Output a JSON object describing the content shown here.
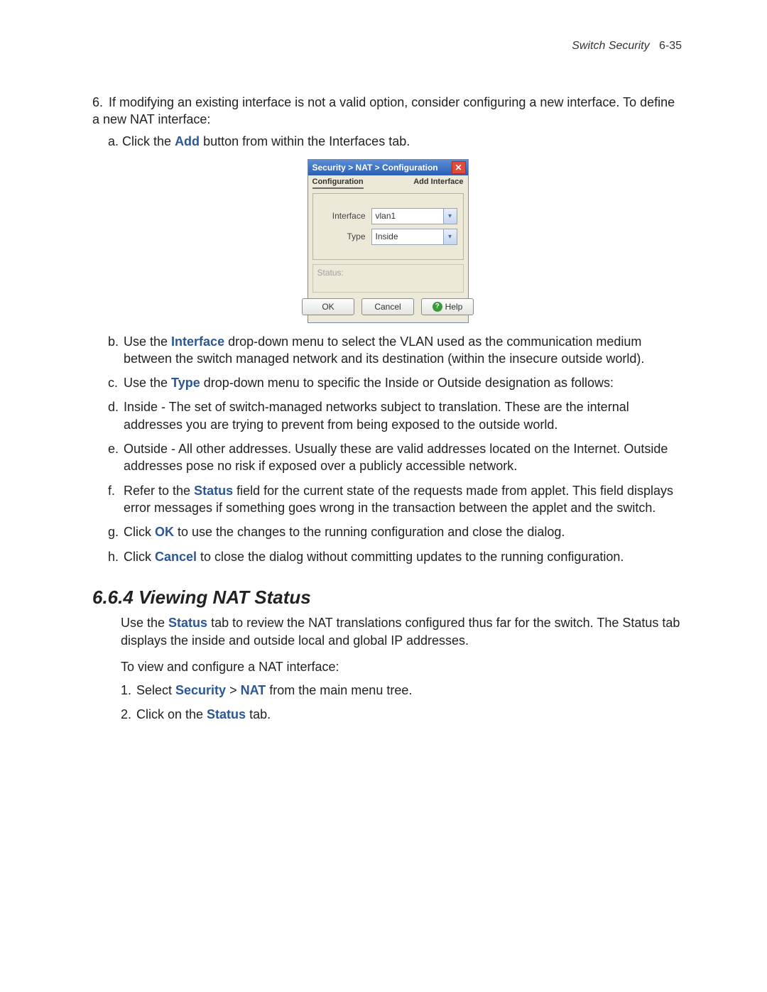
{
  "header": {
    "chapter_title": "Switch Security",
    "page_ref": "6-35"
  },
  "step6": {
    "number": "6.",
    "text": "If modifying an existing interface is not a valid option, consider configuring a new interface. To define a new NAT interface:"
  },
  "sub_a": {
    "letter": "a.",
    "pre": "Click the ",
    "bold": "Add",
    "post": " button from within the Interfaces tab."
  },
  "dialog": {
    "title": "Security > NAT > Configuration",
    "tab_left": "Configuration",
    "tab_right": "Add Interface",
    "rows": {
      "interface_label": "Interface",
      "interface_value": "vlan1",
      "type_label": "Type",
      "type_value": "Inside"
    },
    "status_label": "Status:",
    "buttons": {
      "ok": "OK",
      "cancel": "Cancel",
      "help": "Help"
    }
  },
  "subs": {
    "b": {
      "letter": "b.",
      "t1": "Use the ",
      "bold": "Interface",
      "t2": " drop-down menu to select the VLAN used as the communication medium between the switch managed network and its destination (within the insecure outside world)."
    },
    "c": {
      "letter": "c.",
      "t1": "Use the ",
      "bold": "Type",
      "t2": " drop-down menu to specific the Inside or Outside designation as follows:"
    },
    "d": {
      "letter": "d.",
      "text": "Inside - The set of switch-managed networks subject to translation. These are the internal addresses you are trying to prevent from being exposed to the outside world."
    },
    "e": {
      "letter": "e.",
      "text": "Outside - All other addresses. Usually these are valid addresses located on the Internet. Outside addresses pose no risk if exposed over a publicly accessible network."
    },
    "f": {
      "letter": "f.",
      "t1": "Refer to the ",
      "bold": "Status",
      "t2": " field for the current state of the requests made from applet. This field displays error messages if something goes wrong in the transaction between the applet and the switch."
    },
    "g": {
      "letter": "g.",
      "t1": "Click ",
      "bold": "OK",
      "t2": " to use the changes to the running configuration and close the dialog."
    },
    "h": {
      "letter": "h.",
      "t1": "Click ",
      "bold": "Cancel",
      "t2": " to close the dialog without committing updates to the running configuration."
    }
  },
  "section": {
    "heading": "6.6.4  Viewing NAT Status",
    "intro_t1": "Use the ",
    "intro_bold": "Status",
    "intro_t2": " tab to review the NAT translations configured thus far for the switch. The Status tab displays the inside and outside local and global IP addresses.",
    "lead": "To view and configure a NAT interface:",
    "steps": {
      "s1": {
        "n": "1.",
        "t1": "Select ",
        "b1": "Security",
        "gt": " > ",
        "b2": "NAT",
        "t2": " from the main menu tree."
      },
      "s2": {
        "n": "2.",
        "t1": "Click on the ",
        "bold": "Status",
        "t2": " tab."
      }
    }
  }
}
